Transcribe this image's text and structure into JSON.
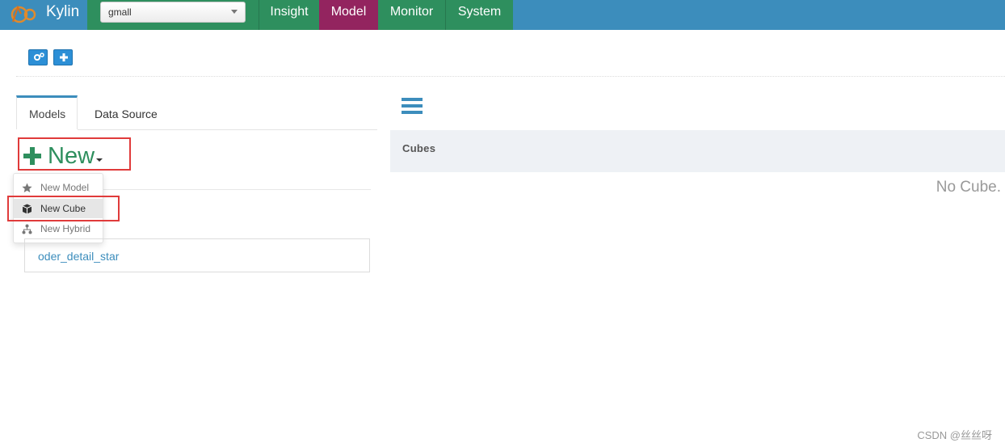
{
  "app": {
    "brand": "Kylin",
    "project": "gmall"
  },
  "nav": {
    "items": [
      "Insight",
      "Model",
      "Monitor",
      "System"
    ],
    "active": "Model"
  },
  "tabs": {
    "models": "Models",
    "data_source": "Data Source"
  },
  "new_button": {
    "label": "New"
  },
  "dropdown": {
    "items": [
      {
        "label": "New Model",
        "icon": "star-icon"
      },
      {
        "label": "New Cube",
        "icon": "cube-icon"
      },
      {
        "label": "New Hybrid",
        "icon": "hybrid-icon"
      }
    ]
  },
  "models": {
    "items": [
      "oder_detail_star"
    ]
  },
  "cubes": {
    "title": "Cubes",
    "empty_text": "No Cube."
  },
  "watermark": "CSDN @丝丝呀",
  "colors": {
    "topbar": "#3c8dbc",
    "nav_green": "#2e8f5e",
    "nav_active": "#93245f",
    "highlight": "#e03b3b"
  }
}
